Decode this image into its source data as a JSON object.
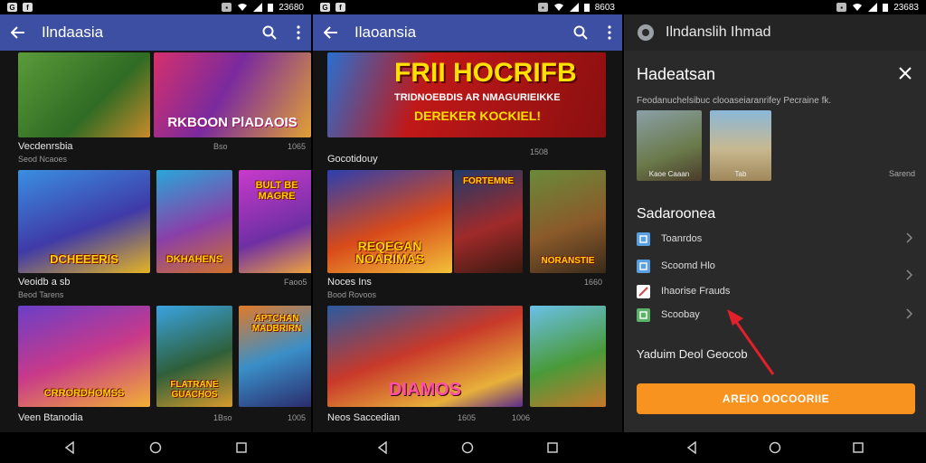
{
  "status": {
    "left_panel_time": "23680",
    "mid_panel_time": "8603",
    "right_panel_time": "23683"
  },
  "panel1": {
    "app_title": "Ilndaasia",
    "banner_left_caption": "",
    "banner_right_caption": "RKBOON PlADAOIS",
    "row1": {
      "title": "Vecdenrsbia",
      "sub": "Seod Ncaoes",
      "meta1": "Bso",
      "meta2": "1065"
    },
    "tiles_row1": [
      {
        "caption": "DCHEEERIS"
      },
      {
        "caption": "DKHAHENS"
      },
      {
        "caption": "BULT BE MAGRE"
      }
    ],
    "row2": {
      "title": "Veoidb a sb",
      "sub": "Beod Tarens",
      "meta": "Faoo5"
    },
    "tiles_row2": [
      {
        "caption": "CRRORDHOMSS"
      },
      {
        "caption": "FLATRANE GUACHOS"
      },
      {
        "caption": "APTCHAN MADBRIRN"
      }
    ],
    "row3": {
      "title": "Veen Btanodia",
      "meta1": "1Bso",
      "meta2": "1005"
    }
  },
  "panel2": {
    "app_title": "Ilaoansia",
    "banner_caption_line1": "FRII HOCRIFB",
    "banner_caption_line2": "TRIDNOEBDIS AR NMAGURIEIKKE",
    "banner_caption_line3": "DEREKER KOCKIEL!",
    "row1_title": "Gocotidouy",
    "row1_meta": "1508",
    "tiles_row1": [
      {
        "caption": "REQEGAN NOARIMAS"
      },
      {
        "caption": "FORTEMNE"
      },
      {
        "caption": "NORANSTIE"
      }
    ],
    "row2": {
      "title": "Noces Ins",
      "sub": "Bood Rovoos",
      "meta": "1660"
    },
    "tiles_row2": [
      {
        "caption": "DIAMOS"
      },
      {
        "caption": ""
      }
    ],
    "row3": {
      "title": "Neos Saccedian",
      "meta1": "1605",
      "meta2": "1006"
    }
  },
  "panel3": {
    "app_title": "Ilndanslih Ihmad",
    "sheet_title": "Hadeatsan",
    "sheet_desc": "Feodanuchelsibuc clooaseiaranrifey Pecraine fk.",
    "thumb1_label": "Kaoe Caaan",
    "thumb2_label": "Tab",
    "side_note": "Sarend",
    "section_title": "Sadaroonea",
    "options": [
      {
        "label": "Toanrdos",
        "color": "#5aa0e0"
      },
      {
        "label": "Scoomd Hlo",
        "color": "#5aa0e0"
      },
      {
        "label": "Ihaorise Frauds",
        "color": "#c94a4a"
      },
      {
        "label": "Scoobay",
        "color": "#5bb36a"
      }
    ],
    "footer_text": "Yaduim Deol Geocob",
    "cta_label": "AREIO OOCOORIIE"
  }
}
